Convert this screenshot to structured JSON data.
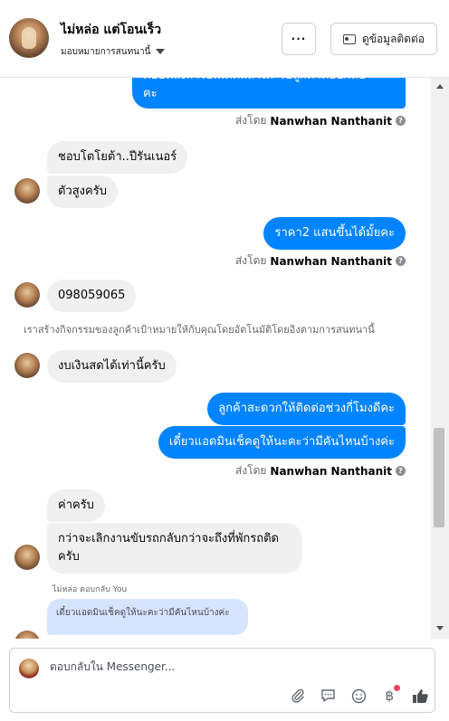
{
  "header": {
    "contact_name": "ไม่หล่อ แต่โอนเร็ว",
    "assignee_label": "มอบหมายการสนทนานี้",
    "more_label": "···",
    "info_button_label": "ดูข้อมูลติดต่อ"
  },
  "messages": {
    "m0_line1": "ตอบหลังการอัพเดตสถานะ รอลูกค้าตอบกลับ",
    "m0_line2": "คะ",
    "m1": "ชอบโตโยต้า..ปีรันเนอร์",
    "m2": "ตัวสูงครับ",
    "m3": "ราคา2 แสนขึ้นได้มั้ยคะ",
    "m4": "098059065",
    "system_note": "เราสร้างกิจกรรมของลูกค้าเป้าหมายให้กับคุณโดยอัตโนมัติโดยอิงตามการสนทนานี้",
    "m5": "งบเงินสดได้เท่านี้ครับ",
    "m6": "ลูกค้าสะดวกให้ติดต่อช่วงกี่โมงดีคะ",
    "m7": "เดี๋ยวแอดมินเช็คดูให้นะคะว่ามีคันไหนบ้างค่ะ",
    "m8": "ค่าครับ",
    "m9_line1": "กว่าจะเลิกงานขับรถกลับกว่าจะถึงที่พักรถติด",
    "m9_line2": "ครับ",
    "reply_label": "ไม่หล่อ ตอบกลับ You",
    "quoted_text": "เดี๋ยวแอดมินเช็คดูให้นะคะว่ามีคันไหนบ้างค่ะ"
  },
  "sent_by": {
    "prefix": "ส่งโดย",
    "name": "Nanwhan Nanthanit",
    "help": "?"
  },
  "composer": {
    "placeholder": "ตอบกลับใน Messenger...",
    "icons": [
      "attachment-icon",
      "saved-reply-icon",
      "emoji-icon",
      "payment-icon",
      "like-icon"
    ],
    "baht_symbol": "฿"
  },
  "colors": {
    "outgoing": "#0084ff",
    "incoming": "#f0f0f0",
    "quoted": "#d6e4ff"
  }
}
